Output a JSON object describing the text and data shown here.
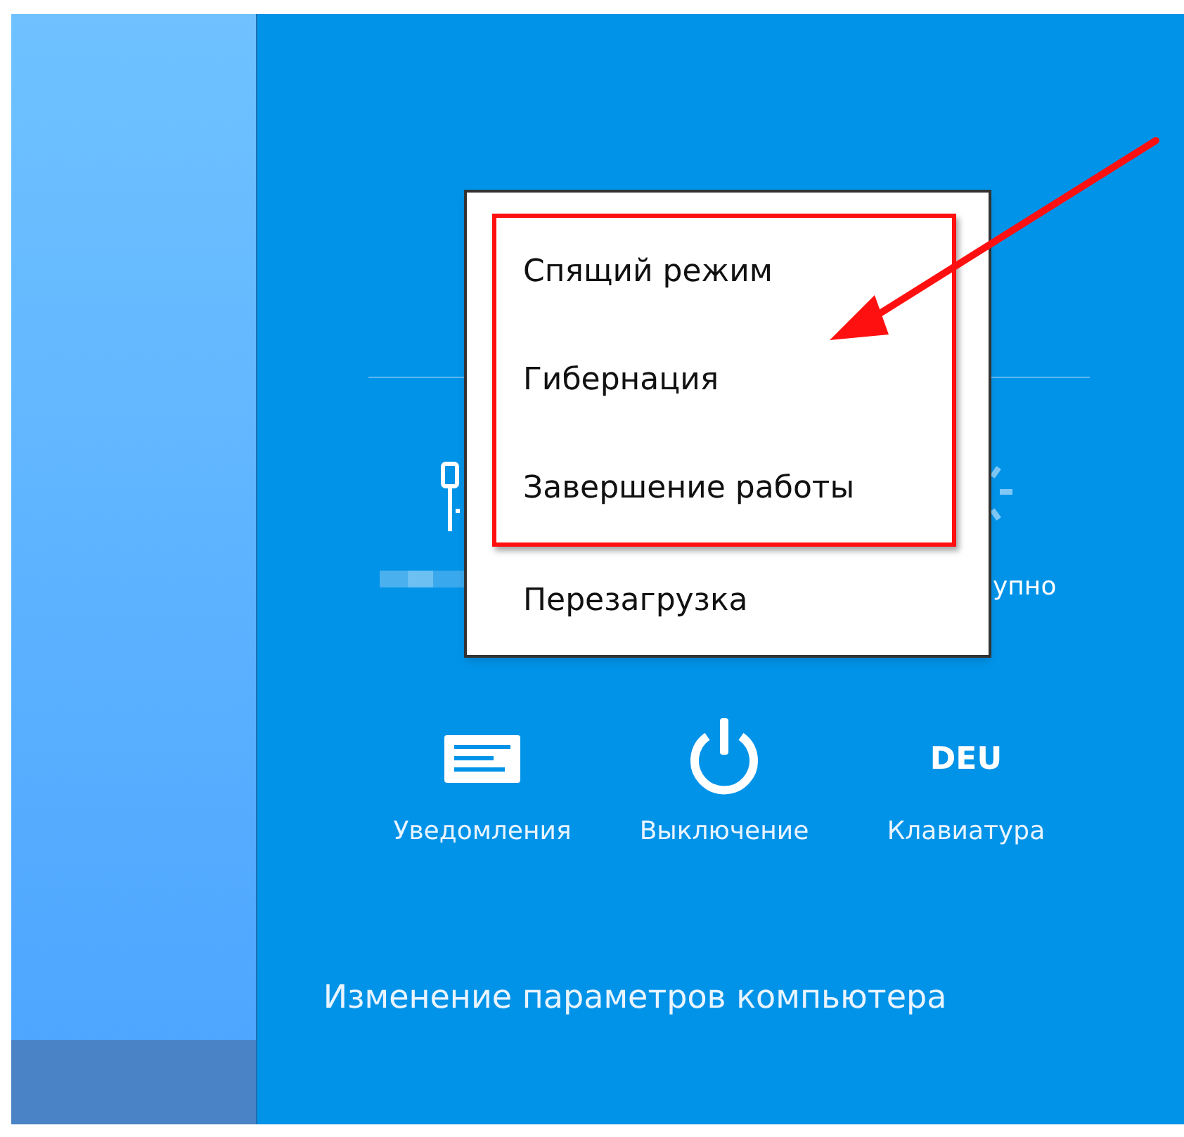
{
  "partial_settings": [
    {
      "kind": "network"
    },
    {
      "kind": "brightness",
      "label": "упно"
    }
  ],
  "power_menu": {
    "items": [
      {
        "label": "Спящий режим",
        "highlighted": true
      },
      {
        "label": "Гибернация",
        "highlighted": true
      },
      {
        "label": "Завершение работы",
        "highlighted": true
      },
      {
        "label": "Перезагрузка",
        "highlighted": false
      }
    ]
  },
  "quick_settings": [
    {
      "kind": "notifications",
      "label": "Уведомления"
    },
    {
      "kind": "power",
      "label": "Выключение"
    },
    {
      "kind": "keyboard",
      "label": "Клавиатура",
      "code": "DEU"
    }
  ],
  "settings_link": "Изменение параметров компьютера"
}
